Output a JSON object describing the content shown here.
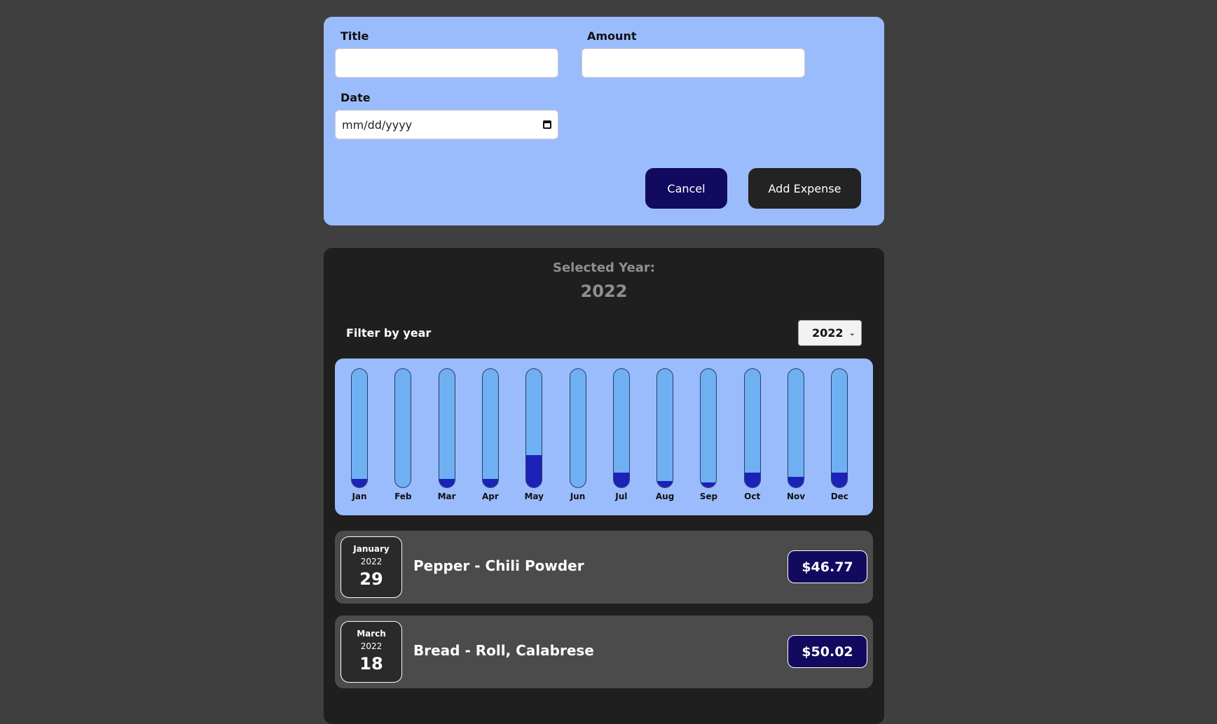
{
  "form": {
    "title_label": "Title",
    "title_value": "",
    "amount_label": "Amount",
    "amount_value": "",
    "date_label": "Date",
    "date_placeholder": "mm/dd/yyyy",
    "cancel_label": "Cancel",
    "add_label": "Add Expense"
  },
  "filter": {
    "selected_label": "Selected Year:",
    "selected_year": "2022",
    "filter_label": "Filter by year",
    "select_value": "2022"
  },
  "chart_data": {
    "type": "bar",
    "categories": [
      "Jan",
      "Feb",
      "Mar",
      "Apr",
      "May",
      "Jun",
      "Jul",
      "Aug",
      "Sep",
      "Oct",
      "Nov",
      "Dec"
    ],
    "values": [
      0.07,
      0.0,
      0.07,
      0.07,
      0.27,
      0.0,
      0.12,
      0.05,
      0.04,
      0.12,
      0.09,
      0.12
    ],
    "ylim": [
      0,
      1
    ],
    "fill_color": "#1c21b8",
    "track_color": "#6fb0f2"
  },
  "expenses": [
    {
      "month": "January",
      "year": "2022",
      "day": "29",
      "title": "Pepper - Chili Powder",
      "amount": "$46.77"
    },
    {
      "month": "March",
      "year": "2022",
      "day": "18",
      "title": "Bread - Roll, Calabrese",
      "amount": "$50.02"
    }
  ]
}
